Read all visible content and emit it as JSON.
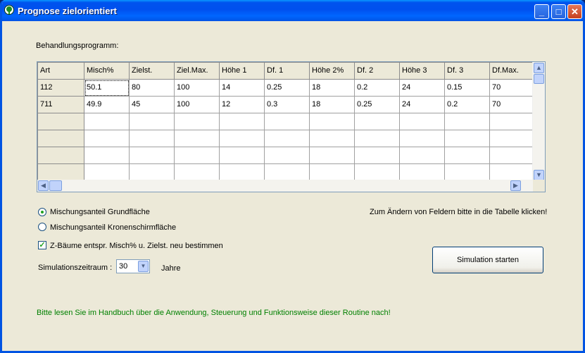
{
  "window": {
    "title": "Prognose zielorientiert",
    "buttons": {
      "minimize": "_",
      "maximize": "□",
      "close": "✕"
    }
  },
  "program_label": "Behandlungsprogramm:",
  "table": {
    "headers": [
      "Art",
      "Misch%",
      "Zielst.",
      "Ziel.Max.",
      "Höhe 1",
      "Df. 1",
      "Höhe 2%",
      "Df. 2",
      "Höhe 3",
      "Df. 3",
      "Df.Max."
    ],
    "rows": [
      [
        "112",
        "50.1",
        "80",
        "100",
        "14",
        "0.25",
        "18",
        "0.2",
        "24",
        "0.15",
        "70"
      ],
      [
        "711",
        "49.9",
        "45",
        "100",
        "12",
        "0.3",
        "18",
        "0.25",
        "24",
        "0.2",
        "70"
      ],
      [
        "",
        "",
        "",
        "",
        "",
        "",
        "",
        "",
        "",
        "",
        ""
      ],
      [
        "",
        "",
        "",
        "",
        "",
        "",
        "",
        "",
        "",
        "",
        ""
      ],
      [
        "",
        "",
        "",
        "",
        "",
        "",
        "",
        "",
        "",
        "",
        ""
      ],
      [
        "",
        "",
        "",
        "",
        "",
        "",
        "",
        "",
        "",
        "",
        ""
      ]
    ]
  },
  "options": {
    "radio_grundflaeche": "Mischungsanteil Grundfläche",
    "radio_kronenschirm": "Mischungsanteil Kronenschirmfläche",
    "selected_radio": "grundflaeche",
    "checkbox_label": "Z-Bäume entspr. Misch% u. Zielst. neu bestimmen",
    "checkbox_checked": true
  },
  "edit_hint": "Zum Ändern von Feldern bitte in die Tabelle klicken!",
  "simulation": {
    "period_label": "Simulationszeitraum :",
    "period_value": "30",
    "unit": "Jahre",
    "start_button": "Simulation starten"
  },
  "manual_hint": "Bitte lesen Sie im Handbuch über die Anwendung, Steuerung und Funktionsweise dieser Routine nach!",
  "icons": {
    "app": "tree-icon",
    "scroll_up": "▲",
    "scroll_down": "▼",
    "scroll_left": "◀",
    "scroll_right": "▶",
    "dropdown": "▼",
    "check": "✓"
  },
  "colors": {
    "titlebar": "#0053ee",
    "window_bg": "#ece9d8",
    "hint_text": "#008000"
  }
}
